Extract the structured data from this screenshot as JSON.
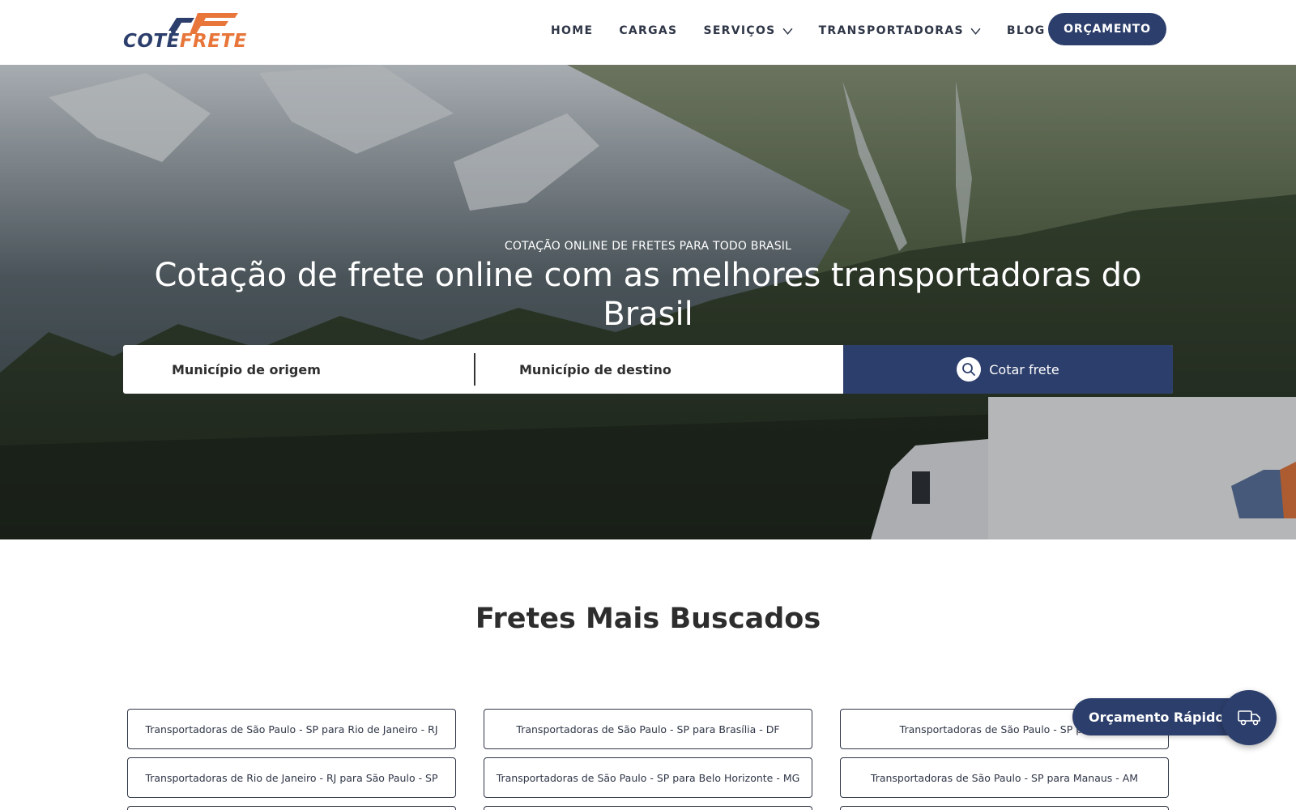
{
  "brand": {
    "name_part1": "COTE",
    "name_part2": "FRETE",
    "primary_color": "#2c3e6b",
    "accent_color": "#e8763a"
  },
  "nav": {
    "items": [
      {
        "label": "HOME",
        "has_dropdown": false
      },
      {
        "label": "CARGAS",
        "has_dropdown": false
      },
      {
        "label": "SERVIÇOS",
        "has_dropdown": true
      },
      {
        "label": "TRANSPORTADORAS",
        "has_dropdown": true
      },
      {
        "label": "BLOG",
        "has_dropdown": false
      }
    ],
    "cta_label": "ORÇAMENTO"
  },
  "hero": {
    "kicker": "COTAÇÃO ONLINE DE FRETES PARA TODO BRASIL",
    "title": "Cotação de frete online com as melhores transportadoras do Brasil",
    "search": {
      "origin_placeholder": "Município de origem",
      "destination_placeholder": "Município de destino",
      "button_label": "Cotar frete"
    }
  },
  "popular": {
    "title": "Fretes Mais Buscados",
    "routes": [
      "Transportadoras de São Paulo - SP para Rio de Janeiro - RJ",
      "Transportadoras de São Paulo - SP para Brasília - DF",
      "Transportadoras de São Paulo - SP para C",
      "Transportadoras de Rio de Janeiro - RJ para São Paulo - SP",
      "Transportadoras de São Paulo - SP para Belo Horizonte - MG",
      "Transportadoras de São Paulo - SP para Manaus - AM"
    ]
  },
  "quick_quote": {
    "label": "Orçamento Rápido",
    "icon": "truck-icon"
  }
}
